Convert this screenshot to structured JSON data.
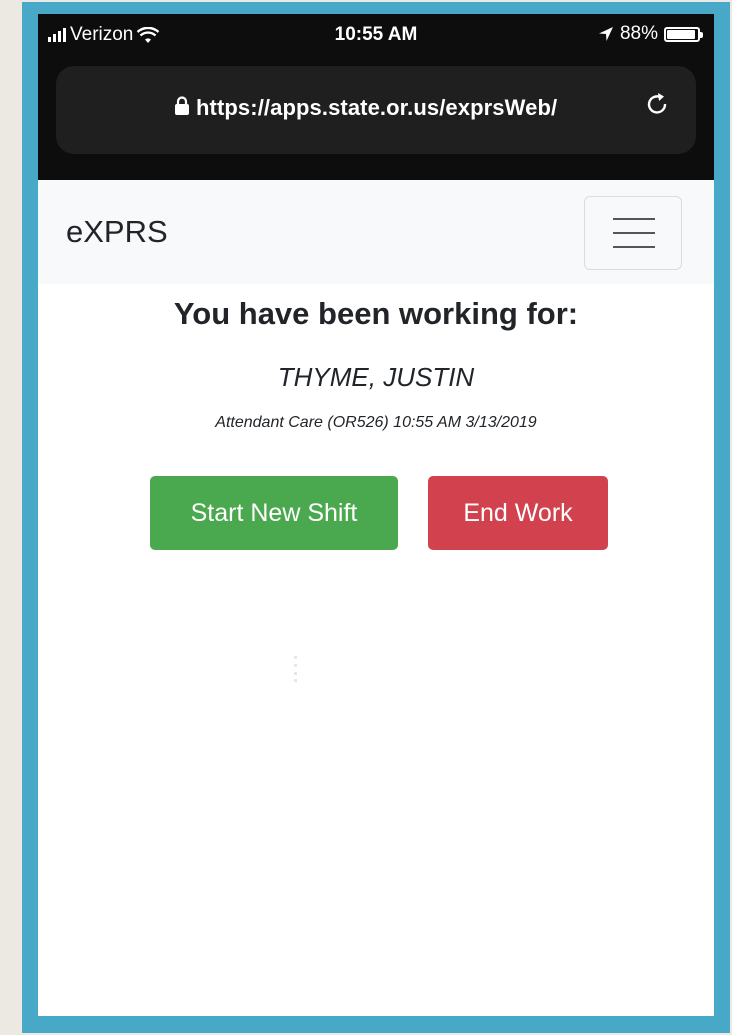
{
  "status_bar": {
    "carrier": "Verizon",
    "time": "10:55 AM",
    "battery": "88%"
  },
  "browser": {
    "url": "https://apps.state.or.us/exprsWeb/"
  },
  "navbar": {
    "brand": "eXPRS"
  },
  "main": {
    "heading": "You have been working for:",
    "client_name": "THYME, JUSTIN",
    "service_detail": "Attendant Care (OR526) 10:55 AM 3/13/2019",
    "start_button": "Start New Shift",
    "end_button": "End Work"
  },
  "colors": {
    "start": "#4aa84f",
    "end": "#d2424e",
    "frame": "#48a8c7"
  },
  "icons": [
    "signal-icon",
    "wifi-icon",
    "location-arrow-icon",
    "battery-icon",
    "lock-icon",
    "reload-icon",
    "hamburger-menu-icon"
  ]
}
